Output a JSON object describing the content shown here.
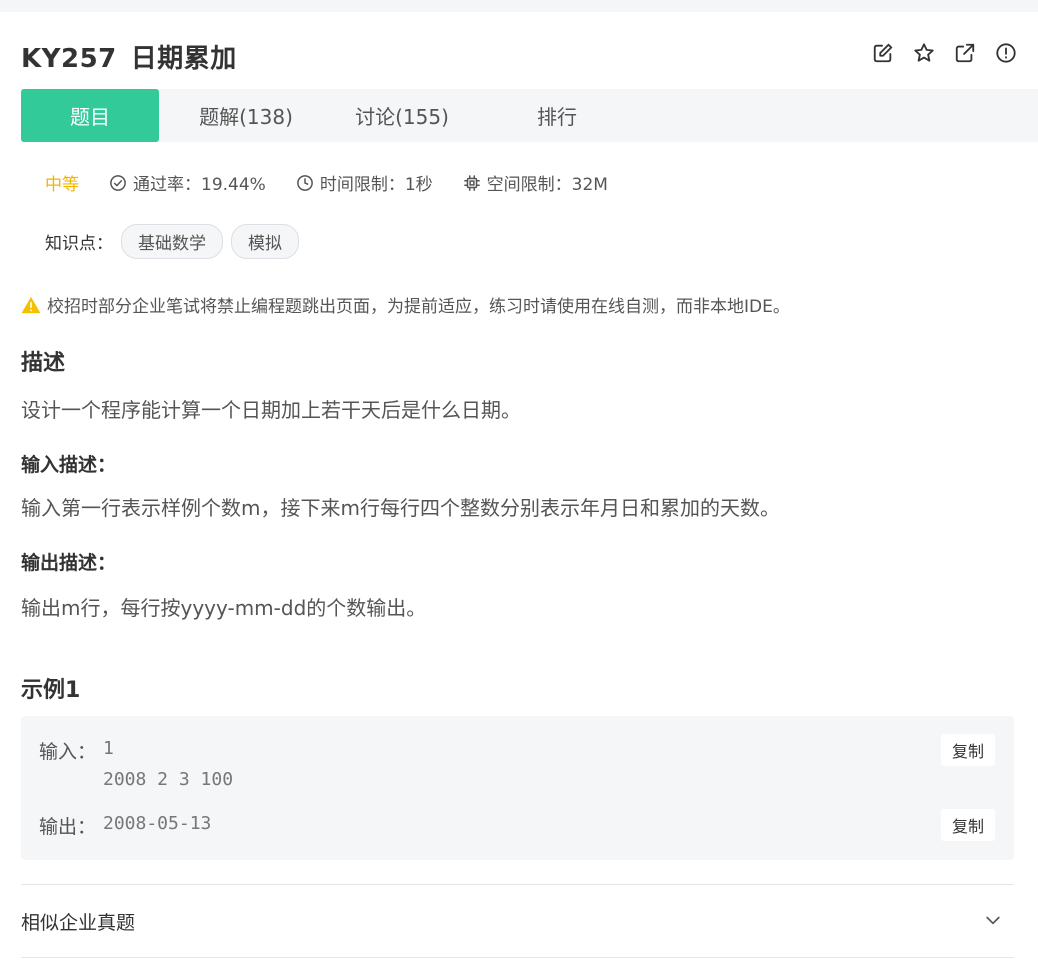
{
  "problem": {
    "id": "KY257",
    "name": "日期累加"
  },
  "tabs": [
    {
      "label": "题目"
    },
    {
      "label": "题解(138)"
    },
    {
      "label": "讨论(155)"
    },
    {
      "label": "排行"
    }
  ],
  "meta": {
    "difficulty": "中等",
    "pass_rate": "通过率：19.44%",
    "time_limit": "时间限制：1秒",
    "space_limit": "空间限制：32M"
  },
  "knowledge": {
    "label": "知识点：",
    "tags": [
      "基础数学",
      "模拟"
    ]
  },
  "warning": "校招时部分企业笔试将禁止编程题跳出页面，为提前适应，练习时请使用在线自测，而非本地IDE。",
  "description": {
    "heading": "描述",
    "text": "设计一个程序能计算一个日期加上若干天后是什么日期。"
  },
  "input_desc": {
    "heading": "输入描述：",
    "text": "输入第一行表示样例个数m，接下来m行每行四个整数分别表示年月日和累加的天数。"
  },
  "output_desc": {
    "heading": "输出描述：",
    "text": "输出m行，每行按yyyy-mm-dd的个数输出。"
  },
  "example": {
    "heading": "示例1",
    "input_label": "输入：",
    "input_value": "1\n2008 2 3 100",
    "output_label": "输出：",
    "output_value": "2008-05-13",
    "copy_label": "复制"
  },
  "similar": {
    "label": "相似企业真题"
  },
  "colors": {
    "accent": "#32ca99",
    "difficulty": "#f1b400",
    "warning": "#f5c000"
  },
  "icons": [
    "edit-icon",
    "star-icon",
    "share-icon",
    "report-icon",
    "check-circle-icon",
    "clock-icon",
    "chip-icon",
    "warning-icon",
    "chevron-down-icon"
  ]
}
